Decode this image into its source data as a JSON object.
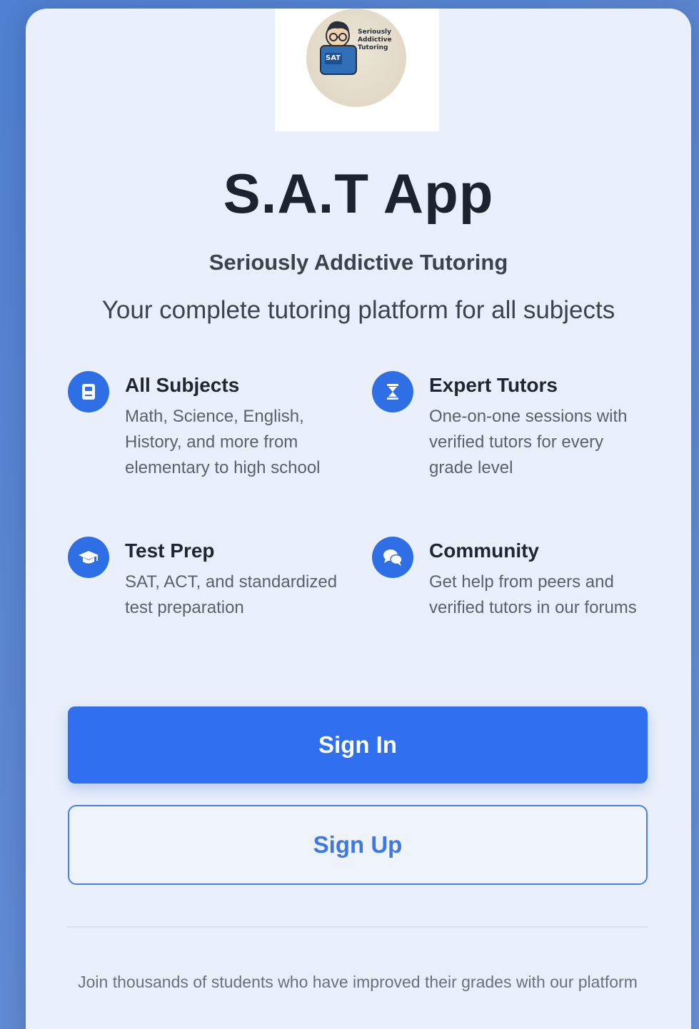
{
  "logo": {
    "badge_text": "SAT",
    "lines": [
      "Seriously",
      "Addictive",
      "Tutoring"
    ]
  },
  "app": {
    "title": "S.A.T App",
    "subtitle": "Seriously Addictive Tutoring",
    "tagline": "Your complete tutoring platform for all subjects"
  },
  "features": [
    {
      "icon": "book-icon",
      "title": "All Subjects",
      "description": "Math, Science, English, History, and more from elementary to high school"
    },
    {
      "icon": "tutor-icon",
      "title": "Expert Tutors",
      "description": "One-on-one sessions with verified tutors for every grade level"
    },
    {
      "icon": "graduation-cap-icon",
      "title": "Test Prep",
      "description": "SAT, ACT, and standardized test preparation"
    },
    {
      "icon": "chat-bubbles-icon",
      "title": "Community",
      "description": "Get help from peers and verified tutors in our forums"
    }
  ],
  "actions": {
    "sign_in_label": "Sign In",
    "sign_up_label": "Sign Up"
  },
  "footer": {
    "text": "Join thousands of students who have improved their grades with our platform"
  },
  "colors": {
    "primary": "#2f6ff0",
    "background": "#5b86cf",
    "card": "#e9f0fb"
  }
}
